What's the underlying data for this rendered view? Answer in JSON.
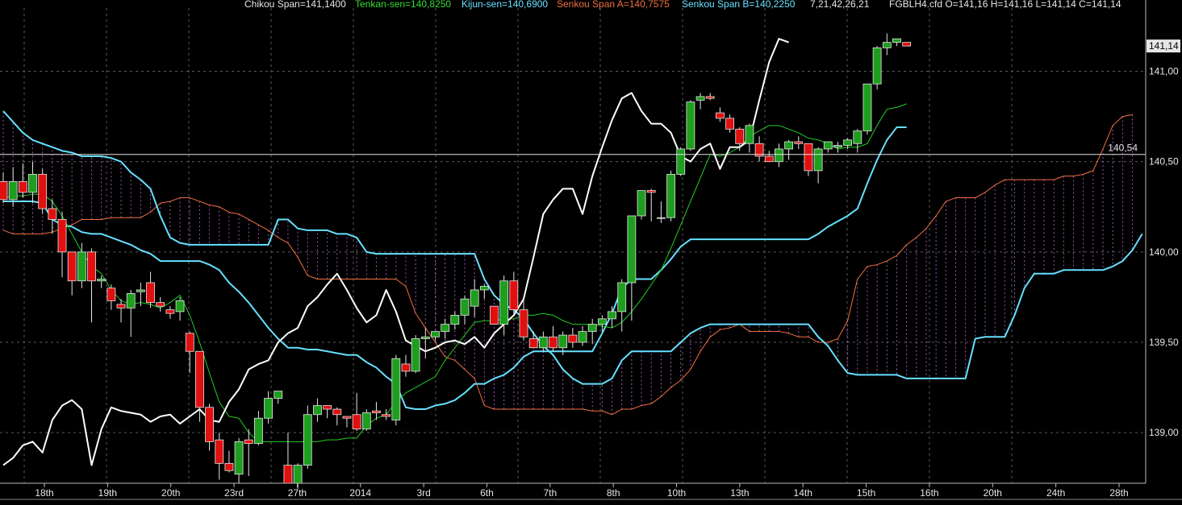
{
  "header": {
    "chikou": "Chikou Span=141,1400",
    "tenkan": "Tenkan-sen=140,8250",
    "kijun": "Kijun-sen=140,6900",
    "senkou_a": "Senkou Span A=140,7575",
    "senkou_b": "Senkou Span B=140,2250",
    "params": "7,21,42,26,21",
    "symbol_ohlc": "FGBLH4.cfd O=141,16 H=141,16 L=141,14 C=141,14"
  },
  "colors": {
    "background": "#000000",
    "grid": "#5a5a5a",
    "up_candle": "#1e9e1e",
    "down_candle": "#e01010",
    "chikou": "#ffffff",
    "tenkan": "#22cc22",
    "kijun": "#66e0ff",
    "senkou_a": "#f07040",
    "senkou_b": "#66e0ff",
    "cloud_hatch": "#c060e0",
    "current_price_label_bg": "#e6e6e6"
  },
  "chart_data": {
    "type": "candlestick",
    "title": "",
    "symbol": "FGBLH4.cfd",
    "ylim": [
      138.72,
      141.35
    ],
    "y_ticks": [
      "141,00",
      "140,50",
      "140,00",
      "139,50",
      "139,00"
    ],
    "x_tick_labels": [
      "18th",
      "19th",
      "20th",
      "23rd",
      "27th",
      "2014",
      "3rd",
      "6th",
      "7th",
      "8th",
      "10th",
      "13th",
      "14th",
      "15th",
      "16th",
      "20th",
      "24th",
      "28th"
    ],
    "current_price_label": "141,14",
    "horizontal_line_label": "140,54",
    "horizontal_line_value": 140.54,
    "grid": true,
    "candles_ohlc": [
      [
        140.39,
        140.44,
        140.27,
        140.29
      ],
      [
        140.29,
        140.47,
        140.25,
        140.39
      ],
      [
        140.39,
        140.49,
        140.3,
        140.33
      ],
      [
        140.33,
        140.5,
        140.27,
        140.43
      ],
      [
        140.43,
        140.46,
        140.21,
        140.24
      ],
      [
        140.24,
        140.29,
        140.1,
        140.18
      ],
      [
        140.18,
        140.22,
        139.86,
        140.0
      ],
      [
        140.0,
        139.99,
        139.76,
        139.84
      ],
      [
        139.84,
        140.05,
        139.8,
        140.0
      ],
      [
        140.0,
        140.02,
        139.61,
        139.84
      ],
      [
        139.84,
        139.87,
        139.8,
        139.85
      ],
      [
        139.8,
        139.82,
        139.68,
        139.73
      ],
      [
        139.71,
        139.74,
        139.61,
        139.69
      ],
      [
        139.69,
        139.79,
        139.53,
        139.77
      ],
      [
        139.78,
        139.83,
        139.7,
        139.79
      ],
      [
        139.83,
        139.89,
        139.69,
        139.72
      ],
      [
        139.72,
        139.75,
        139.67,
        139.7
      ],
      [
        139.68,
        139.7,
        139.63,
        139.66
      ],
      [
        139.67,
        139.75,
        139.62,
        139.73
      ],
      [
        139.55,
        139.56,
        139.33,
        139.45
      ],
      [
        139.45,
        139.42,
        139.06,
        139.14
      ],
      [
        139.14,
        139.16,
        138.9,
        138.95
      ],
      [
        138.96,
        139.0,
        138.74,
        138.83
      ],
      [
        138.83,
        138.9,
        138.78,
        138.79
      ],
      [
        138.77,
        138.97,
        138.72,
        138.95
      ],
      [
        138.96,
        139.02,
        138.76,
        138.94
      ],
      [
        138.94,
        139.12,
        138.93,
        139.08
      ],
      [
        139.08,
        139.23,
        139.05,
        139.19
      ],
      [
        139.19,
        139.23,
        139.16,
        139.23
      ],
      [
        138.82,
        139.0,
        138.72,
        138.72
      ],
      [
        138.72,
        138.83,
        138.69,
        138.82
      ],
      [
        138.82,
        139.15,
        138.8,
        139.1
      ],
      [
        139.1,
        139.19,
        139.06,
        139.15
      ],
      [
        139.15,
        139.15,
        139.08,
        139.13
      ],
      [
        139.13,
        139.14,
        139.04,
        139.1
      ],
      [
        139.09,
        139.09,
        139.03,
        139.08
      ],
      [
        139.1,
        139.22,
        139.01,
        139.02
      ],
      [
        139.02,
        139.13,
        139.01,
        139.11
      ],
      [
        139.12,
        139.17,
        139.07,
        139.11
      ],
      [
        139.1,
        139.13,
        139.07,
        139.09
      ],
      [
        139.07,
        139.43,
        139.04,
        139.41
      ],
      [
        139.38,
        139.43,
        139.31,
        139.34
      ],
      [
        139.34,
        139.54,
        139.33,
        139.52
      ],
      [
        139.52,
        139.58,
        139.41,
        139.53
      ],
      [
        139.53,
        139.56,
        139.51,
        139.56
      ],
      [
        139.56,
        139.63,
        139.52,
        139.6
      ],
      [
        139.6,
        139.67,
        139.57,
        139.65
      ],
      [
        139.65,
        139.76,
        139.6,
        139.74
      ],
      [
        139.7,
        139.85,
        139.64,
        139.79
      ],
      [
        139.79,
        139.82,
        139.74,
        139.81
      ],
      [
        139.7,
        139.7,
        139.6,
        139.6
      ],
      [
        139.6,
        139.87,
        139.54,
        139.84
      ],
      [
        139.84,
        139.89,
        139.65,
        139.68
      ],
      [
        139.68,
        139.74,
        139.51,
        139.53
      ],
      [
        139.52,
        139.56,
        139.48,
        139.47
      ],
      [
        139.47,
        139.56,
        139.45,
        139.53
      ],
      [
        139.53,
        139.59,
        139.45,
        139.47
      ],
      [
        139.47,
        139.56,
        139.43,
        139.54
      ],
      [
        139.54,
        139.58,
        139.47,
        139.5
      ],
      [
        139.5,
        139.59,
        139.48,
        139.56
      ],
      [
        139.56,
        139.63,
        139.49,
        139.6
      ],
      [
        139.6,
        139.65,
        139.56,
        139.63
      ],
      [
        139.63,
        139.7,
        139.58,
        139.67
      ],
      [
        139.67,
        139.85,
        139.56,
        139.83
      ],
      [
        139.83,
        140.2,
        139.62,
        140.2
      ],
      [
        140.2,
        140.33,
        140.18,
        140.34
      ],
      [
        140.34,
        140.35,
        140.17,
        140.33
      ],
      [
        140.19,
        140.28,
        140.16,
        140.19
      ],
      [
        140.19,
        140.45,
        140.17,
        140.43
      ],
      [
        140.43,
        140.58,
        140.42,
        140.57
      ],
      [
        140.57,
        140.84,
        140.56,
        140.83
      ],
      [
        140.84,
        140.88,
        140.79,
        140.86
      ],
      [
        140.86,
        140.88,
        140.84,
        140.85
      ],
      [
        140.77,
        140.8,
        140.72,
        140.74
      ],
      [
        140.74,
        140.76,
        140.66,
        140.68
      ],
      [
        140.68,
        140.69,
        140.56,
        140.6
      ],
      [
        140.6,
        140.71,
        140.55,
        140.7
      ],
      [
        140.6,
        140.64,
        140.5,
        140.53
      ],
      [
        140.53,
        140.56,
        140.5,
        140.5
      ],
      [
        140.5,
        140.6,
        140.47,
        140.57
      ],
      [
        140.57,
        140.62,
        140.51,
        140.61
      ],
      [
        140.61,
        140.64,
        140.57,
        140.6
      ],
      [
        140.6,
        140.6,
        140.42,
        140.45
      ],
      [
        140.45,
        140.58,
        140.38,
        140.57
      ],
      [
        140.57,
        140.61,
        140.55,
        140.61
      ],
      [
        140.58,
        140.61,
        140.55,
        140.59
      ],
      [
        140.59,
        140.63,
        140.57,
        140.62
      ],
      [
        140.6,
        140.68,
        140.55,
        140.67
      ],
      [
        140.67,
        140.93,
        140.65,
        140.93
      ],
      [
        140.93,
        141.14,
        140.9,
        141.13
      ],
      [
        141.13,
        141.21,
        141.09,
        141.16
      ],
      [
        141.16,
        141.18,
        141.14,
        141.18
      ],
      [
        141.16,
        141.16,
        141.14,
        141.14
      ]
    ],
    "series": [
      {
        "name": "Tenkan-sen",
        "values": [
          140.3,
          140.31,
          140.31,
          140.32,
          140.32,
          140.28,
          140.2,
          140.1,
          140.0,
          139.92,
          139.88,
          139.79,
          139.73,
          139.71,
          139.72,
          139.71,
          139.69,
          139.72,
          139.76,
          139.65,
          139.5,
          139.33,
          139.17,
          139.09,
          139.08,
          139.0,
          138.95,
          138.95,
          138.95,
          138.95,
          138.95,
          138.95,
          138.95,
          138.96,
          138.96,
          138.97,
          138.97,
          139.04,
          139.08,
          139.1,
          139.17,
          139.22,
          139.25,
          139.28,
          139.31,
          139.4,
          139.47,
          139.54,
          139.61,
          139.62,
          139.62,
          139.63,
          139.63,
          139.65,
          139.65,
          139.66,
          139.65,
          139.62,
          139.6,
          139.6,
          139.6,
          139.59,
          139.58,
          139.61,
          139.67,
          139.74,
          139.82,
          139.9,
          140.02,
          140.15,
          140.28,
          140.41,
          140.54,
          140.53,
          140.55,
          140.58,
          140.64,
          140.67,
          140.7,
          140.7,
          140.68,
          140.66,
          140.63,
          140.62,
          140.6,
          140.57,
          140.58,
          140.58,
          140.6,
          140.7,
          140.79,
          140.8,
          140.82
        ]
      },
      {
        "name": "Kijun-sen",
        "values": [
          140.28,
          140.28,
          140.28,
          140.28,
          140.27,
          140.18,
          140.15,
          140.14,
          140.11,
          140.1,
          140.1,
          140.08,
          140.06,
          140.04,
          140.01,
          139.99,
          139.95,
          139.95,
          139.95,
          139.95,
          139.95,
          139.93,
          139.9,
          139.83,
          139.78,
          139.72,
          139.65,
          139.58,
          139.52,
          139.47,
          139.47,
          139.46,
          139.46,
          139.45,
          139.44,
          139.43,
          139.43,
          139.39,
          139.36,
          139.31,
          139.27,
          139.14,
          139.13,
          139.13,
          139.15,
          139.16,
          139.18,
          139.22,
          139.27,
          139.27,
          139.3,
          139.32,
          139.36,
          139.42,
          139.45,
          139.45,
          139.45,
          139.45,
          139.45,
          139.45,
          139.45,
          139.55,
          139.66,
          139.8,
          139.85,
          139.85,
          139.85,
          139.9,
          139.96,
          140.03,
          140.07,
          140.07,
          140.07,
          140.07,
          140.07,
          140.07,
          140.07,
          140.07,
          140.07,
          140.07,
          140.07,
          140.07,
          140.07,
          140.1,
          140.14,
          140.17,
          140.2,
          140.24,
          140.38,
          140.51,
          140.62,
          140.69,
          140.69
        ]
      },
      {
        "name": "Chikou Span",
        "values": [
          138.82,
          138.86,
          138.93,
          138.95,
          138.89,
          139.07,
          139.15,
          139.18,
          139.13,
          138.82,
          139.02,
          139.14,
          139.12,
          139.11,
          139.1,
          139.06,
          139.09,
          139.1,
          139.05,
          139.09,
          139.13,
          139.07,
          139.06,
          139.17,
          139.24,
          139.35,
          139.38,
          139.4,
          139.5,
          139.55,
          139.58,
          139.7,
          139.75,
          139.82,
          139.88,
          139.79,
          139.69,
          139.61,
          139.65,
          139.79,
          139.67,
          139.51,
          139.48,
          139.45,
          139.47,
          139.5,
          139.51,
          139.49,
          139.53,
          139.47,
          139.55,
          139.6,
          139.65,
          139.74,
          139.97,
          140.21,
          140.29,
          140.35,
          140.35,
          140.21,
          140.42,
          140.58,
          140.73,
          140.85,
          140.88,
          140.78,
          140.71,
          140.71,
          140.66,
          140.53,
          140.5,
          140.57,
          140.6,
          140.46,
          140.58,
          140.58,
          140.62,
          140.84,
          141.05,
          141.18,
          141.16
        ]
      }
    ],
    "cloud": {
      "senkou_a": [
        140.12,
        140.1,
        140.1,
        140.1,
        140.1,
        140.11,
        140.13,
        140.15,
        140.18,
        140.18,
        140.18,
        140.19,
        140.19,
        140.19,
        140.19,
        140.22,
        140.27,
        140.28,
        140.3,
        140.3,
        140.28,
        140.26,
        140.25,
        140.22,
        140.21,
        140.18,
        140.15,
        140.12,
        140.08,
        140.05,
        139.97,
        139.87,
        139.85,
        139.85,
        139.85,
        139.85,
        139.85,
        139.85,
        139.85,
        139.85,
        139.85,
        139.81,
        139.66,
        139.58,
        139.5,
        139.42,
        139.4,
        139.35,
        139.3,
        139.15,
        139.13,
        139.13,
        139.13,
        139.13,
        139.13,
        139.13,
        139.13,
        139.13,
        139.13,
        139.13,
        139.12,
        139.12,
        139.1,
        139.13,
        139.13,
        139.15,
        139.16,
        139.2,
        139.25,
        139.29,
        139.35,
        139.45,
        139.53,
        139.57,
        139.58,
        139.6,
        139.56,
        139.56,
        139.56,
        139.56,
        139.55,
        139.53,
        139.53,
        139.5,
        139.5,
        139.52,
        139.62,
        139.85,
        139.92,
        139.93,
        139.95,
        139.98,
        140.04,
        140.08,
        140.13,
        140.2,
        140.28,
        140.3,
        140.3,
        140.3,
        140.33,
        140.37,
        140.4,
        140.4,
        140.4,
        140.4,
        140.4,
        140.4,
        140.42,
        140.42,
        140.43,
        140.45,
        140.57,
        140.7,
        140.75,
        140.76
      ],
      "senkou_b": [
        140.78,
        140.72,
        140.66,
        140.62,
        140.6,
        140.58,
        140.56,
        140.55,
        140.53,
        140.53,
        140.53,
        140.52,
        140.5,
        140.44,
        140.4,
        140.35,
        140.2,
        140.08,
        140.05,
        140.04,
        140.04,
        140.04,
        140.04,
        140.04,
        140.04,
        140.04,
        140.04,
        140.04,
        140.18,
        140.18,
        140.13,
        140.12,
        140.12,
        140.12,
        140.1,
        140.1,
        140.08,
        140.0,
        139.99,
        139.99,
        139.99,
        139.99,
        139.99,
        139.99,
        139.99,
        139.99,
        139.99,
        139.99,
        139.99,
        139.85,
        139.76,
        139.71,
        139.68,
        139.63,
        139.55,
        139.48,
        139.43,
        139.35,
        139.3,
        139.27,
        139.27,
        139.27,
        139.3,
        139.4,
        139.45,
        139.45,
        139.45,
        139.45,
        139.45,
        139.5,
        139.55,
        139.58,
        139.6,
        139.6,
        139.6,
        139.6,
        139.6,
        139.6,
        139.6,
        139.6,
        139.6,
        139.6,
        139.6,
        139.53,
        139.48,
        139.4,
        139.33,
        139.32,
        139.32,
        139.32,
        139.32,
        139.32,
        139.3,
        139.3,
        139.3,
        139.3,
        139.3,
        139.3,
        139.3,
        139.52,
        139.53,
        139.53,
        139.53,
        139.65,
        139.8,
        139.88,
        139.88,
        139.88,
        139.9,
        139.9,
        139.9,
        139.9,
        139.9,
        139.92,
        139.95,
        140.01,
        140.1,
        140.23,
        140.23,
        140.23
      ]
    }
  }
}
